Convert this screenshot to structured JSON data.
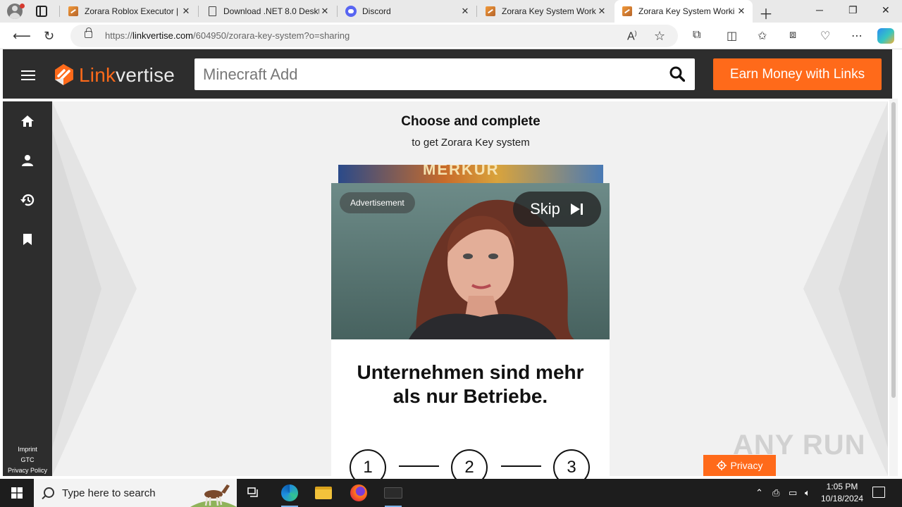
{
  "browser": {
    "tabs": [
      {
        "title": "Zorara Roblox Executor |",
        "favicon": "zorara-favicon",
        "active": false
      },
      {
        "title": "Download .NET 8.0 Deskt",
        "favicon": "document-favicon",
        "active": false
      },
      {
        "title": "Discord",
        "favicon": "discord-favicon",
        "active": false
      },
      {
        "title": "Zorara Key System Worki",
        "favicon": "zorara-favicon",
        "active": false
      },
      {
        "title": "Zorara Key System Worki",
        "favicon": "zorara-favicon",
        "active": true
      }
    ],
    "url_prefix": "https://",
    "url_host": "linkvertise.com",
    "url_path": "/604950/zorara-key-system?o=sharing"
  },
  "header": {
    "logo_link": "Link",
    "logo_vertise": "vertise",
    "search_placeholder": "Minecraft Add",
    "earn_button": "Earn Money with Links"
  },
  "sidebar": {
    "icons": [
      "home-icon",
      "user-icon",
      "history-icon",
      "bookmark-icon"
    ],
    "links": [
      "Imprint",
      "GTC",
      "Privacy Policy"
    ]
  },
  "main": {
    "title": "Choose and complete",
    "subtitle": "to get Zorara Key system",
    "banner_text": "MERKUR",
    "ad": {
      "badge": "Advertisement",
      "skip": "Skip",
      "headline_line1": "Unternehmen sind mehr",
      "headline_line2": "als nur Betriebe.",
      "steps": [
        "1",
        "2",
        "3"
      ]
    },
    "privacy_button": "Privacy",
    "watermark": "ANY RUN"
  },
  "taskbar": {
    "search_placeholder": "Type here to search",
    "time": "1:05 PM",
    "date": "10/18/2024"
  },
  "colors": {
    "accent": "#ff6a1a",
    "header_bg": "#2d2d2d",
    "page_bg": "#f1f1f1"
  }
}
